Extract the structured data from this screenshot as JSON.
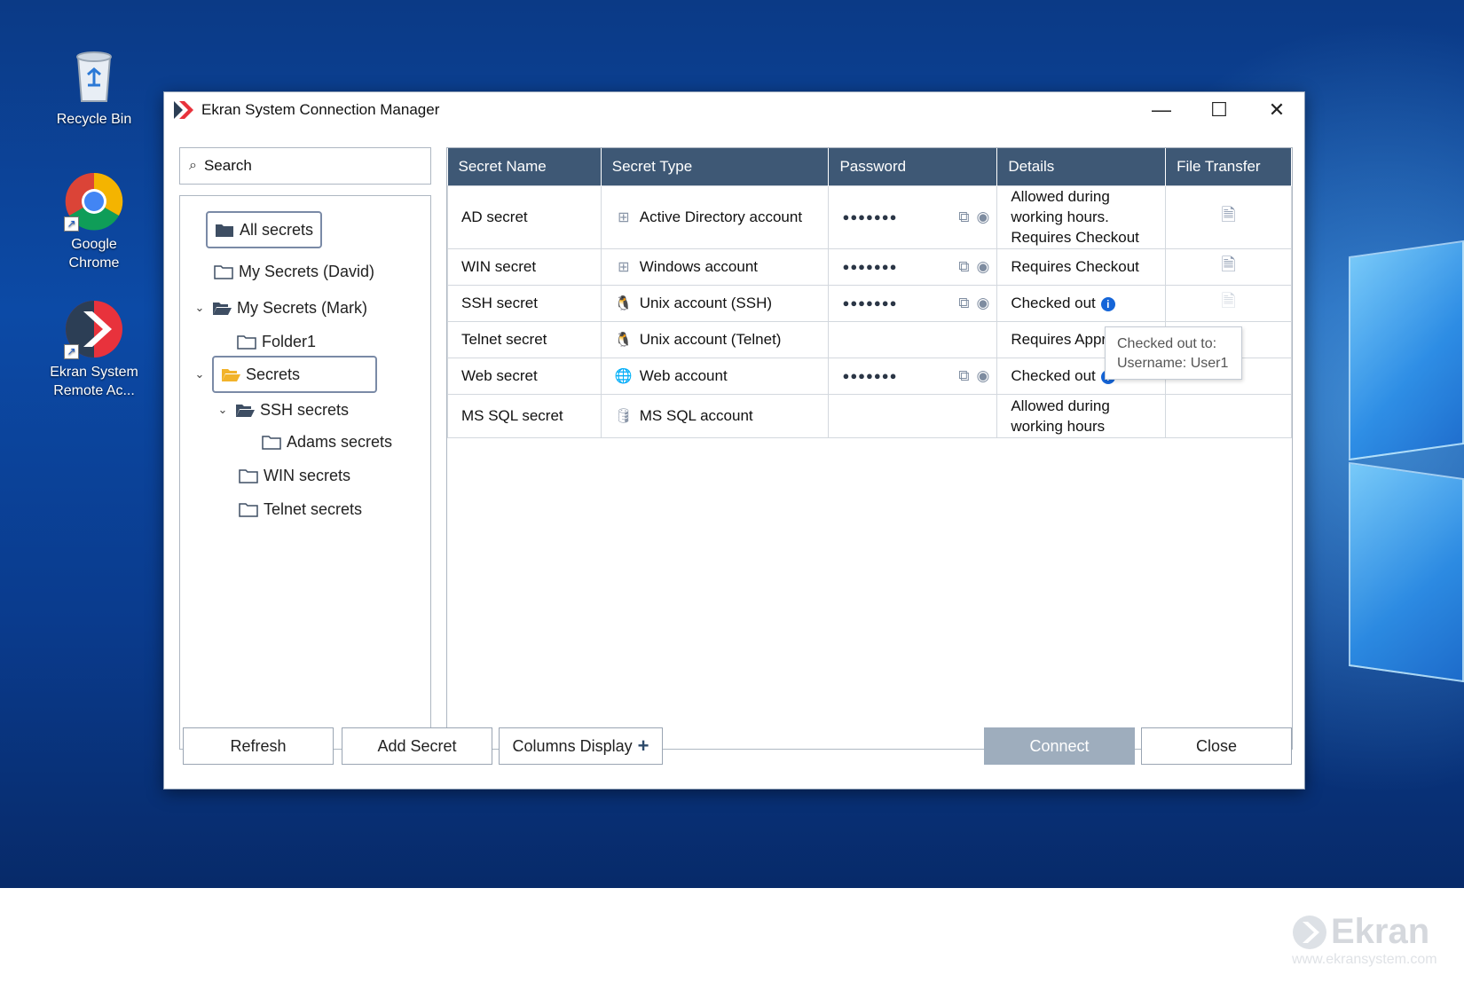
{
  "desktop": {
    "icons": [
      {
        "label": "Recycle Bin"
      },
      {
        "label": "Google Chrome"
      },
      {
        "label": "Ekran System Remote Ac..."
      }
    ]
  },
  "window": {
    "title": "Ekran System Connection Manager",
    "controls": {
      "minimize": "—",
      "maximize": "☐",
      "close": "✕"
    }
  },
  "search": {
    "placeholder": "Search"
  },
  "tree": {
    "items": [
      {
        "label": "All secrets"
      },
      {
        "label": "My Secrets (David)"
      },
      {
        "label": "My Secrets (Mark)"
      },
      {
        "label": "Folder1"
      },
      {
        "label": "Secrets"
      },
      {
        "label": "SSH secrets"
      },
      {
        "label": "Adams secrets"
      },
      {
        "label": "WIN secrets"
      },
      {
        "label": "Telnet secrets"
      }
    ]
  },
  "table": {
    "columns": [
      "Secret Name",
      "Secret Type",
      "Password",
      "Details",
      "File Transfer"
    ],
    "rows": [
      {
        "name": "AD secret",
        "type": "Active Directory account",
        "type_icon": "windows-icon",
        "password": "●●●●●●●",
        "details": "Allowed during working hours. Requires Checkout",
        "file_transfer": "enabled"
      },
      {
        "name": "WIN secret",
        "type": "Windows account",
        "type_icon": "windows-icon",
        "password": "●●●●●●●",
        "details": "Requires Checkout",
        "file_transfer": "enabled"
      },
      {
        "name": "SSH secret",
        "type": "Unix account (SSH)",
        "type_icon": "linux-icon",
        "password": "●●●●●●●",
        "details": "Checked out",
        "file_transfer": "disabled"
      },
      {
        "name": "Telnet secret",
        "type": "Unix account (Telnet)",
        "type_icon": "linux-icon",
        "password": "",
        "details": "Requires Appr",
        "file_transfer": "none"
      },
      {
        "name": "Web secret",
        "type": "Web account",
        "type_icon": "globe-icon",
        "password": "●●●●●●●",
        "details": "Checked out",
        "file_transfer": "none"
      },
      {
        "name": "MS SQL secret",
        "type": "MS SQL account",
        "type_icon": "database-icon",
        "password": "",
        "details": "Allowed during working hours",
        "file_transfer": "none"
      }
    ]
  },
  "tooltip": {
    "line1": "Checked out to:",
    "line2": "Username: User1"
  },
  "buttons": {
    "refresh": "Refresh",
    "add_secret": "Add Secret",
    "columns_display": "Columns Display",
    "connect": "Connect",
    "close": "Close"
  },
  "watermark": {
    "brand": "Ekran",
    "url": "www.ekransystem.com"
  },
  "colors": {
    "header_bg": "#3e5875",
    "accent": "#1565d8",
    "connect_disabled": "#9eadbd"
  }
}
